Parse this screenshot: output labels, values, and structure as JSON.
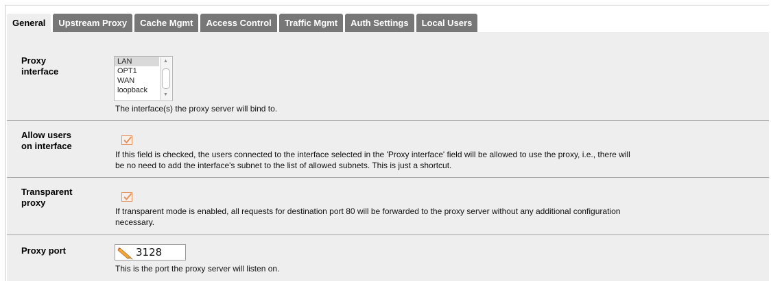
{
  "tabs": [
    {
      "label": "General",
      "active": true
    },
    {
      "label": "Upstream Proxy"
    },
    {
      "label": "Cache Mgmt"
    },
    {
      "label": "Access Control"
    },
    {
      "label": "Traffic Mgmt"
    },
    {
      "label": "Auth Settings"
    },
    {
      "label": "Local Users"
    }
  ],
  "proxy_interface": {
    "label_line1": "Proxy",
    "label_line2": "interface",
    "options": [
      "LAN",
      "OPT1",
      "WAN",
      "loopback"
    ],
    "selected": "LAN",
    "description": "The interface(s) the proxy server will bind to."
  },
  "allow_users": {
    "label_line1": "Allow users",
    "label_line2": "on interface",
    "checked": true,
    "description_line1": "If this field is checked, the users connected to the interface selected in the 'Proxy interface' field will be allowed to use the proxy, i.e., there will",
    "description_line2": "be no need to add the interface's subnet to the list of allowed subnets. This is just a shortcut."
  },
  "transparent_proxy": {
    "label_line1": "Transparent",
    "label_line2": "proxy",
    "checked": true,
    "description_line1": "If transparent mode is enabled, all requests for destination port 80 will be forwarded to the proxy server without any additional configuration",
    "description_line2": "necessary."
  },
  "proxy_port": {
    "label": "Proxy port",
    "value": "3128",
    "description": "This is the port the proxy server will listen on."
  },
  "colors": {
    "tab_bg": "#777777",
    "tab_active_bg": "#eeeeee",
    "panel_bg": "#eeeeee",
    "checkbox_accent": "#e4935d"
  },
  "icons": {
    "checkbox": "checkmark-icon",
    "port_field": "pencil-icon"
  }
}
